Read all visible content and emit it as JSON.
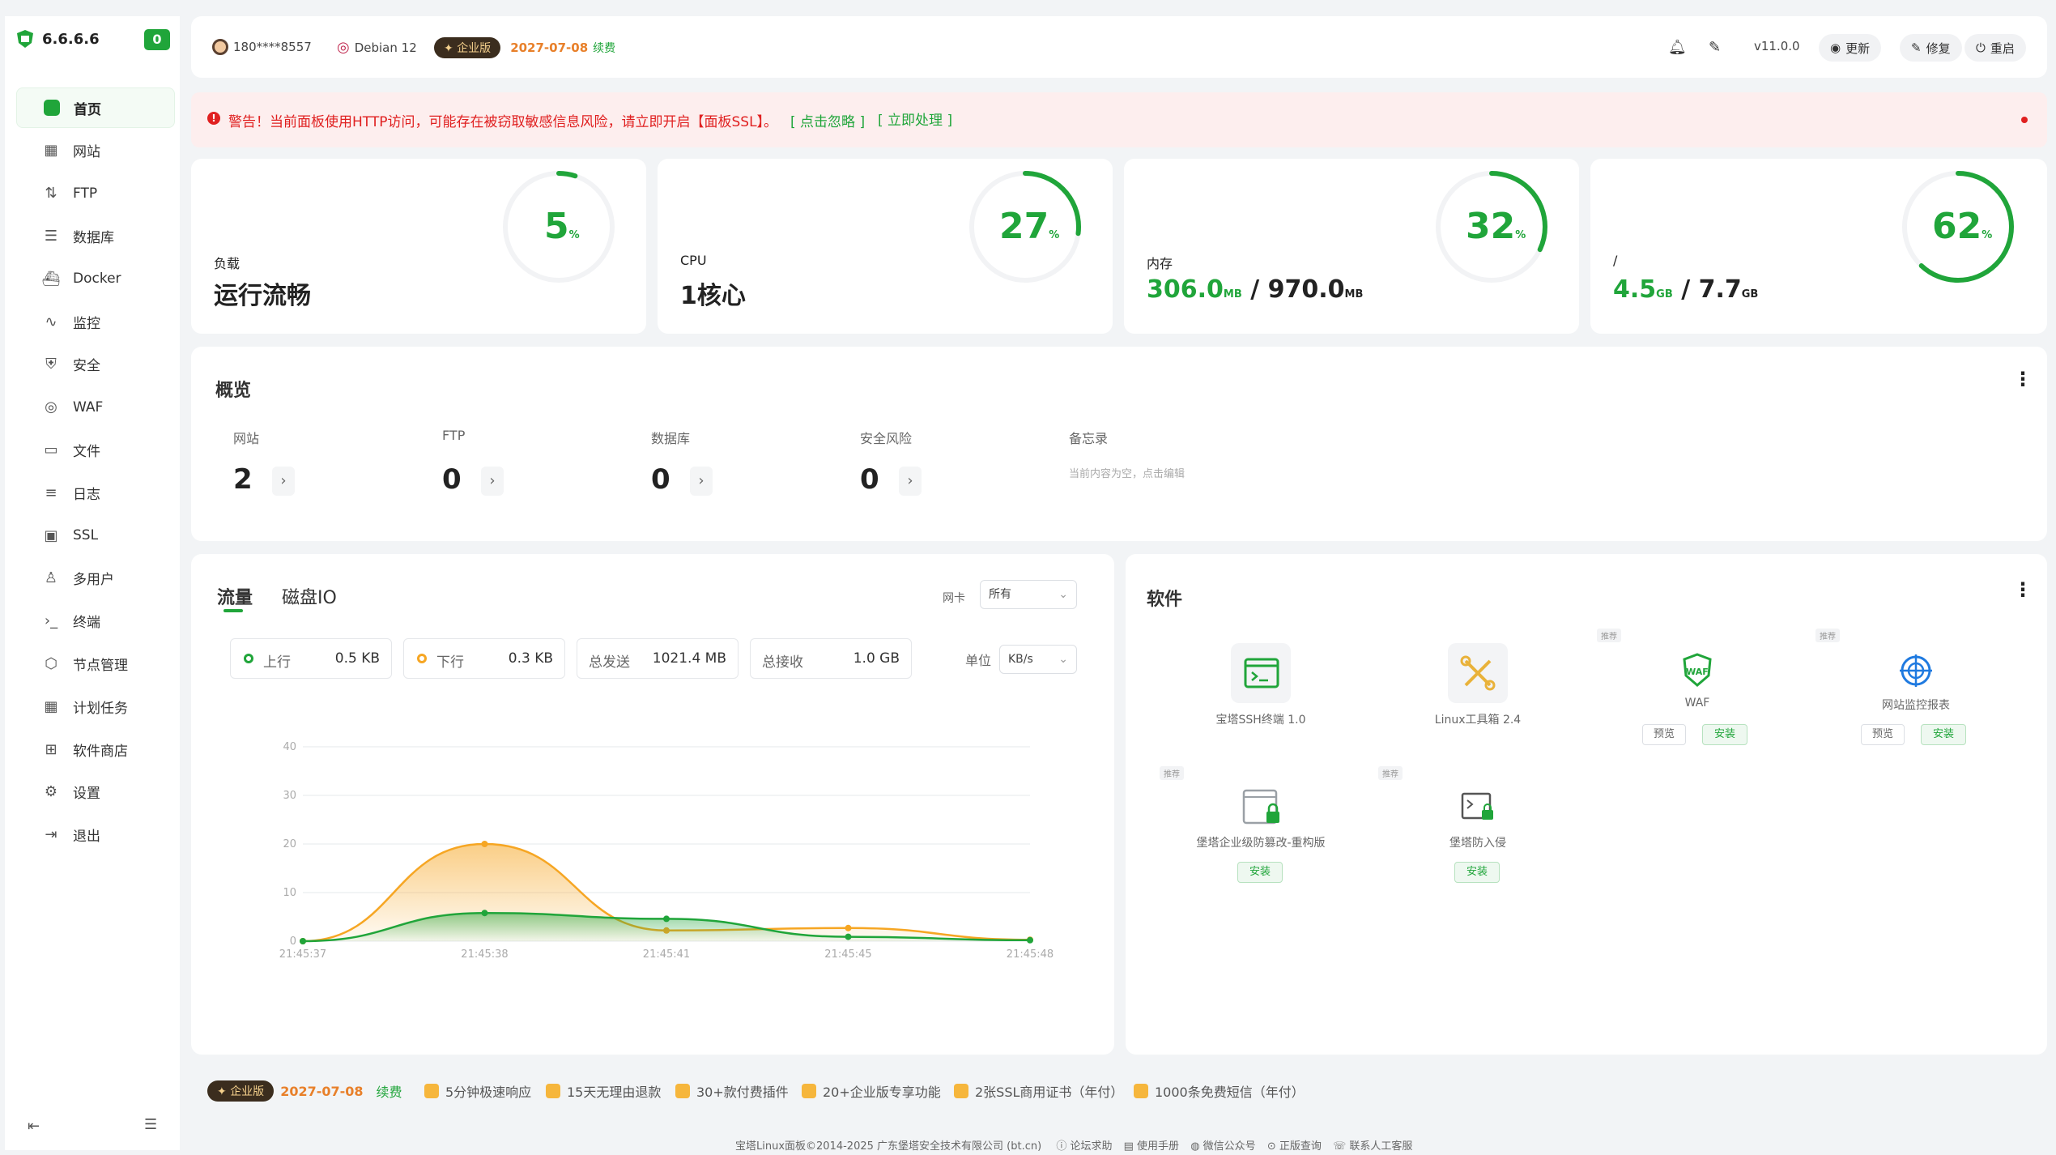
{
  "sidebar": {
    "brand": "6.6.6.6",
    "badge": "0",
    "items": [
      {
        "label": "首页",
        "icon": "home-icon",
        "active": true
      },
      {
        "label": "网站",
        "icon": "website-icon"
      },
      {
        "label": "FTP",
        "icon": "ftp-icon"
      },
      {
        "label": "数据库",
        "icon": "database-icon"
      },
      {
        "label": "Docker",
        "icon": "docker-icon"
      },
      {
        "label": "监控",
        "icon": "monitor-icon"
      },
      {
        "label": "安全",
        "icon": "shield-icon"
      },
      {
        "label": "WAF",
        "icon": "waf-icon"
      },
      {
        "label": "文件",
        "icon": "folder-icon"
      },
      {
        "label": "日志",
        "icon": "log-icon"
      },
      {
        "label": "SSL",
        "icon": "ssl-icon"
      },
      {
        "label": "多用户",
        "icon": "user-icon"
      },
      {
        "label": "终端",
        "icon": "terminal-icon"
      },
      {
        "label": "节点管理",
        "icon": "node-icon"
      },
      {
        "label": "计划任务",
        "icon": "calendar-icon"
      },
      {
        "label": "软件商店",
        "icon": "store-icon"
      },
      {
        "label": "设置",
        "icon": "settings-icon"
      },
      {
        "label": "退出",
        "icon": "logout-icon"
      }
    ]
  },
  "header": {
    "user": "180****8557",
    "os": "Debian 12",
    "edition": "企业版",
    "expire": "2027-07-08",
    "renew": "续费",
    "version": "v11.0.0",
    "update": "更新",
    "repair": "修复",
    "restart": "重启"
  },
  "warning": {
    "text": "警告！当前面板使用HTTP访问，可能存在被窃取敏感信息风险，请立即开启【面板SSL】。",
    "ignore": "[ 点击忽略 ]",
    "fix": "[ 立即处理 ]"
  },
  "stats": [
    {
      "label": "负载",
      "value": "运行流畅",
      "percent": 5
    },
    {
      "label": "CPU",
      "value": "1核心",
      "percent": 27
    },
    {
      "label": "内存",
      "used": "306.0",
      "used_unit": "MB",
      "total": "970.0",
      "total_unit": "MB",
      "percent": 32
    },
    {
      "label": "/",
      "used": "4.5",
      "used_unit": "GB",
      "total": "7.7",
      "total_unit": "GB",
      "percent": 62
    }
  ],
  "ring_unit": "%",
  "overview": {
    "title": "概览",
    "items": [
      {
        "label": "网站",
        "value": "2"
      },
      {
        "label": "FTP",
        "value": "0"
      },
      {
        "label": "数据库",
        "value": "0"
      },
      {
        "label": "安全风险",
        "value": "0"
      }
    ],
    "memo_label": "备忘录",
    "memo_placeholder": "当前内容为空，点击编辑"
  },
  "traffic": {
    "tab_flow": "流量",
    "tab_disk": "磁盘IO",
    "nic_label": "网卡",
    "nic_value": "所有",
    "up_label": "上行",
    "up_value": "0.5 KB",
    "down_label": "下行",
    "down_value": "0.3 KB",
    "sent_label": "总发送",
    "sent_value": "1021.4 MB",
    "recv_label": "总接收",
    "recv_value": "1.0 GB",
    "unit_label": "单位",
    "unit_value": "KB/s"
  },
  "chart_data": {
    "type": "area",
    "x": [
      "21:45:37",
      "21:45:38",
      "21:45:41",
      "21:45:45",
      "21:45:48"
    ],
    "series": [
      {
        "name": "下行",
        "color": "#f6a623",
        "values": [
          0,
          20,
          2.2,
          2.7,
          0.3
        ]
      },
      {
        "name": "上行",
        "color": "#20a53a",
        "values": [
          0,
          5.8,
          4.6,
          0.9,
          0.2
        ]
      }
    ],
    "ylim": [
      0,
      40
    ],
    "yticks": [
      "0",
      "10",
      "20",
      "30",
      "40"
    ],
    "grid": true
  },
  "software": {
    "title": "软件",
    "tag": "推荐",
    "items": [
      {
        "label": "宝塔SSH终端 1.0",
        "icon": "ssh-terminal-icon"
      },
      {
        "label": "Linux工具箱 2.4",
        "icon": "toolbox-icon"
      },
      {
        "label": "WAF",
        "icon": "waf-shield-icon",
        "preview": "预览",
        "install": "安装"
      },
      {
        "label": "网站监控报表",
        "icon": "site-monitor-icon",
        "preview": "预览",
        "install": "安装"
      },
      {
        "label": "堡塔企业级防篡改-重构版",
        "icon": "tamper-proof-icon",
        "install": "安装"
      },
      {
        "label": "堡塔防入侵",
        "icon": "intrusion-icon",
        "install": "安装"
      }
    ]
  },
  "footer": {
    "edition": "企业版",
    "expire": "2027-07-08",
    "renew": "续费",
    "features": [
      "5分钟极速响应",
      "15天无理由退款",
      "30+款付费插件",
      "20+企业版专享功能",
      "2张SSL商用证书（年付）",
      "1000条免费短信（年付）"
    ],
    "copyright": "宝塔Linux面板©2014-2025 广东堡塔安全技术有限公司 (bt.cn)",
    "links": [
      "论坛求助",
      "使用手册",
      "微信公众号",
      "正版查询",
      "联系人工客服"
    ]
  },
  "colors": {
    "accent": "#20a53a",
    "warning": "#e02020",
    "orange": "#f6a623"
  }
}
